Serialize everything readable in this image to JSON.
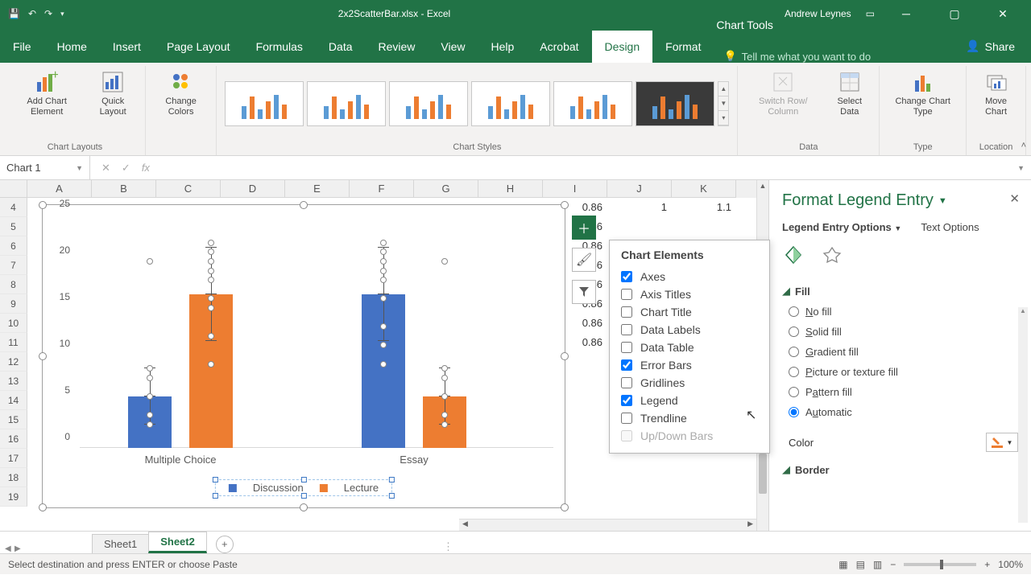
{
  "titlebar": {
    "doc": "2x2ScatterBar.xlsx - Excel",
    "user": "Andrew Leynes",
    "context": "Chart Tools"
  },
  "tabs": [
    "File",
    "Home",
    "Insert",
    "Page Layout",
    "Formulas",
    "Data",
    "Review",
    "View",
    "Help",
    "Acrobat",
    "Design",
    "Format"
  ],
  "tell_me": "Tell me what you want to do",
  "share": "Share",
  "ribbon": {
    "add_el": "Add Chart Element",
    "quick": "Quick Layout",
    "colors": "Change Colors",
    "switch": "Switch Row/ Column",
    "select": "Select Data",
    "change_type": "Change Chart Type",
    "move": "Move Chart",
    "g1": "Chart Layouts",
    "g2": "Chart Styles",
    "g3": "Data",
    "g4": "Type",
    "g5": "Location"
  },
  "namebox": "Chart 1",
  "fx": "fx",
  "cols": [
    "A",
    "B",
    "C",
    "D",
    "E",
    "F",
    "G",
    "H",
    "I",
    "J",
    "K"
  ],
  "rows": [
    "4",
    "5",
    "6",
    "7",
    "8",
    "9",
    "10",
    "11",
    "12",
    "13",
    "14",
    "15",
    "16",
    "17",
    "18",
    "19"
  ],
  "cell_vals": {
    "I4": "0.86",
    "J4": "1",
    "K4": "1.1",
    "I5": "0.86",
    "I6": "0.86",
    "I7": "0.86",
    "I8": "0.86",
    "I9": "0.86",
    "I10": "0.86",
    "I11": "0.86"
  },
  "chart_elements": {
    "title": "Chart Elements",
    "items": [
      {
        "label": "Axes",
        "checked": true
      },
      {
        "label": "Axis Titles",
        "checked": false
      },
      {
        "label": "Chart Title",
        "checked": false
      },
      {
        "label": "Data Labels",
        "checked": false
      },
      {
        "label": "Data Table",
        "checked": false
      },
      {
        "label": "Error Bars",
        "checked": true
      },
      {
        "label": "Gridlines",
        "checked": false
      },
      {
        "label": "Legend",
        "checked": true
      },
      {
        "label": "Trendline",
        "checked": false
      },
      {
        "label": "Up/Down Bars",
        "checked": false,
        "disabled": true
      }
    ]
  },
  "pane": {
    "title": "Format Legend Entry",
    "tab1": "Legend Entry Options",
    "tab2": "Text Options",
    "section": "Fill",
    "opts": [
      "No fill",
      "Solid fill",
      "Gradient fill",
      "Picture or texture fill",
      "Pattern fill",
      "Automatic"
    ],
    "color": "Color",
    "border": "Border"
  },
  "sheets": [
    "Sheet1",
    "Sheet2"
  ],
  "status": "Select destination and press ENTER or choose Paste",
  "zoom": "100%",
  "chart_data": {
    "type": "bar",
    "categories": [
      "Multiple Choice",
      "Essay"
    ],
    "series": [
      {
        "name": "Discussion",
        "values": [
          5.5,
          16.5
        ],
        "errors": [
          3,
          5
        ]
      },
      {
        "name": "Lecture",
        "values": [
          16.5,
          5.5
        ],
        "errors": [
          5,
          3
        ]
      }
    ],
    "scatter": [
      {
        "cx": 0,
        "series": 0,
        "ys": [
          2.5,
          3.5,
          5.5,
          7.5,
          8.5,
          20
        ]
      },
      {
        "cx": 0,
        "series": 1,
        "ys": [
          9,
          9,
          12,
          15,
          16,
          18,
          19,
          20,
          21,
          22
        ]
      },
      {
        "cx": 1,
        "series": 0,
        "ys": [
          9,
          11,
          13,
          16,
          18,
          19,
          20,
          21,
          22
        ]
      },
      {
        "cx": 1,
        "series": 1,
        "ys": [
          2.5,
          3.5,
          5.5,
          7.5,
          8.5,
          20
        ]
      }
    ],
    "ylabel": "",
    "xlabel": "",
    "title": "",
    "ylim": [
      0,
      25
    ],
    "yticks": [
      0,
      5,
      10,
      15,
      20,
      25
    ],
    "legend_pos": "bottom"
  }
}
